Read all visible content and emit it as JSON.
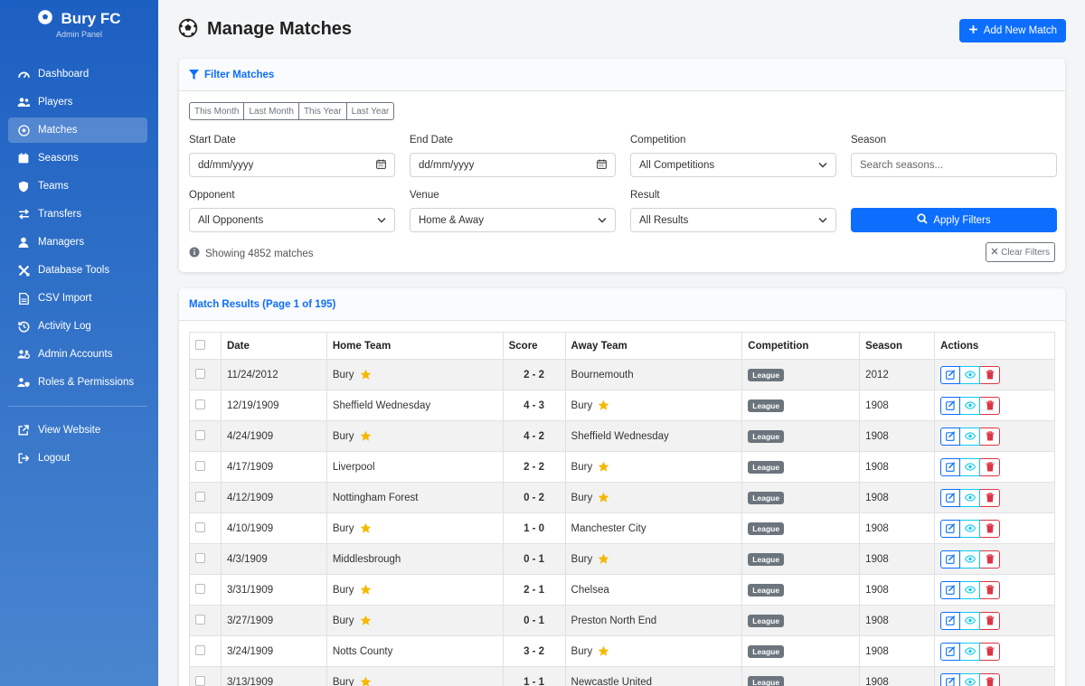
{
  "sidebar": {
    "brand": "Bury FC",
    "subtitle": "Admin Panel",
    "items": [
      {
        "label": "Dashboard",
        "icon": "gauge-icon"
      },
      {
        "label": "Players",
        "icon": "users-icon"
      },
      {
        "label": "Matches",
        "icon": "football-icon",
        "active": true
      },
      {
        "label": "Seasons",
        "icon": "calendar-icon"
      },
      {
        "label": "Teams",
        "icon": "shield-icon"
      },
      {
        "label": "Transfers",
        "icon": "exchange-icon"
      },
      {
        "label": "Managers",
        "icon": "user-icon"
      },
      {
        "label": "Database Tools",
        "icon": "tools-icon"
      },
      {
        "label": "CSV Import",
        "icon": "file-csv-icon"
      },
      {
        "label": "Activity Log",
        "icon": "history-icon"
      },
      {
        "label": "Admin Accounts",
        "icon": "users-cog-icon"
      },
      {
        "label": "Roles & Permissions",
        "icon": "user-shield-icon"
      }
    ],
    "footer_items": [
      {
        "label": "View Website",
        "icon": "external-link-icon"
      },
      {
        "label": "Logout",
        "icon": "sign-out-icon"
      }
    ]
  },
  "header": {
    "title": "Manage Matches",
    "add_button": "Add New Match"
  },
  "filters": {
    "title": "Filter Matches",
    "quick": [
      "This Month",
      "Last Month",
      "This Year",
      "Last Year"
    ],
    "start_date": {
      "label": "Start Date",
      "placeholder": "dd/mm/yyyy"
    },
    "end_date": {
      "label": "End Date",
      "placeholder": "dd/mm/yyyy"
    },
    "competition": {
      "label": "Competition",
      "value": "All Competitions"
    },
    "season": {
      "label": "Season",
      "placeholder": "Search seasons..."
    },
    "opponent": {
      "label": "Opponent",
      "value": "All Opponents"
    },
    "venue": {
      "label": "Venue",
      "value": "Home & Away"
    },
    "result": {
      "label": "Result",
      "value": "All Results"
    },
    "apply_button": "Apply Filters",
    "clear_button": "Clear Filters",
    "showing": "Showing 4852 matches"
  },
  "results": {
    "title": "Match Results (Page 1 of 195)",
    "columns": [
      "Date",
      "Home Team",
      "Score",
      "Away Team",
      "Competition",
      "Season",
      "Actions"
    ],
    "rows": [
      {
        "date": "11/24/2012",
        "home": "Bury",
        "score": "2 - 2",
        "away": "Bournemouth",
        "competition": "League",
        "season": "2012",
        "bury": "home"
      },
      {
        "date": "12/19/1909",
        "home": "Sheffield Wednesday",
        "score": "4 - 3",
        "away": "Bury",
        "competition": "League",
        "season": "1908",
        "bury": "away"
      },
      {
        "date": "4/24/1909",
        "home": "Bury",
        "score": "4 - 2",
        "away": "Sheffield Wednesday",
        "competition": "League",
        "season": "1908",
        "bury": "home"
      },
      {
        "date": "4/17/1909",
        "home": "Liverpool",
        "score": "2 - 2",
        "away": "Bury",
        "competition": "League",
        "season": "1908",
        "bury": "away"
      },
      {
        "date": "4/12/1909",
        "home": "Nottingham Forest",
        "score": "0 - 2",
        "away": "Bury",
        "competition": "League",
        "season": "1908",
        "bury": "away"
      },
      {
        "date": "4/10/1909",
        "home": "Bury",
        "score": "1 - 0",
        "away": "Manchester City",
        "competition": "League",
        "season": "1908",
        "bury": "home"
      },
      {
        "date": "4/3/1909",
        "home": "Middlesbrough",
        "score": "0 - 1",
        "away": "Bury",
        "competition": "League",
        "season": "1908",
        "bury": "away"
      },
      {
        "date": "3/31/1909",
        "home": "Bury",
        "score": "2 - 1",
        "away": "Chelsea",
        "competition": "League",
        "season": "1908",
        "bury": "home"
      },
      {
        "date": "3/27/1909",
        "home": "Bury",
        "score": "0 - 1",
        "away": "Preston North End",
        "competition": "League",
        "season": "1908",
        "bury": "home"
      },
      {
        "date": "3/24/1909",
        "home": "Notts County",
        "score": "3 - 2",
        "away": "Bury",
        "competition": "League",
        "season": "1908",
        "bury": "away"
      },
      {
        "date": "3/13/1909",
        "home": "Bury",
        "score": "1 - 1",
        "away": "Newcastle United",
        "competition": "League",
        "season": "1908",
        "bury": "home"
      }
    ]
  },
  "colors": {
    "primary": "#0d6efd",
    "sidebar": "#1c5fc2",
    "star": "#f5b800",
    "danger": "#dc3545",
    "info": "#0dcaf0"
  }
}
